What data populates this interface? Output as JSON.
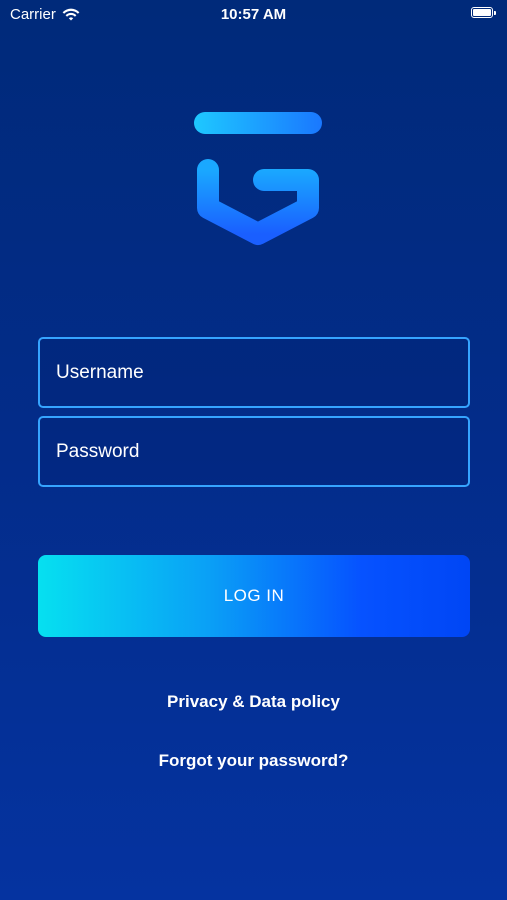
{
  "status_bar": {
    "carrier": "Carrier",
    "time": "10:57 AM"
  },
  "login_form": {
    "username_placeholder": "Username",
    "password_placeholder": "Password",
    "login_label": "LOG IN"
  },
  "links": {
    "privacy": "Privacy & Data policy",
    "forgot_password": "Forgot your password?"
  },
  "icons": {
    "logo": "shield-logo-icon",
    "wifi": "wifi-icon",
    "battery": "battery-icon"
  },
  "colors": {
    "background": "#032c8a",
    "field_border": "#36a4ff",
    "button_gradient_start": "#06e0f0",
    "button_gradient_end": "#0046f5",
    "logo_top": "#1ec8ff",
    "logo_bottom": "#1a6bff"
  }
}
